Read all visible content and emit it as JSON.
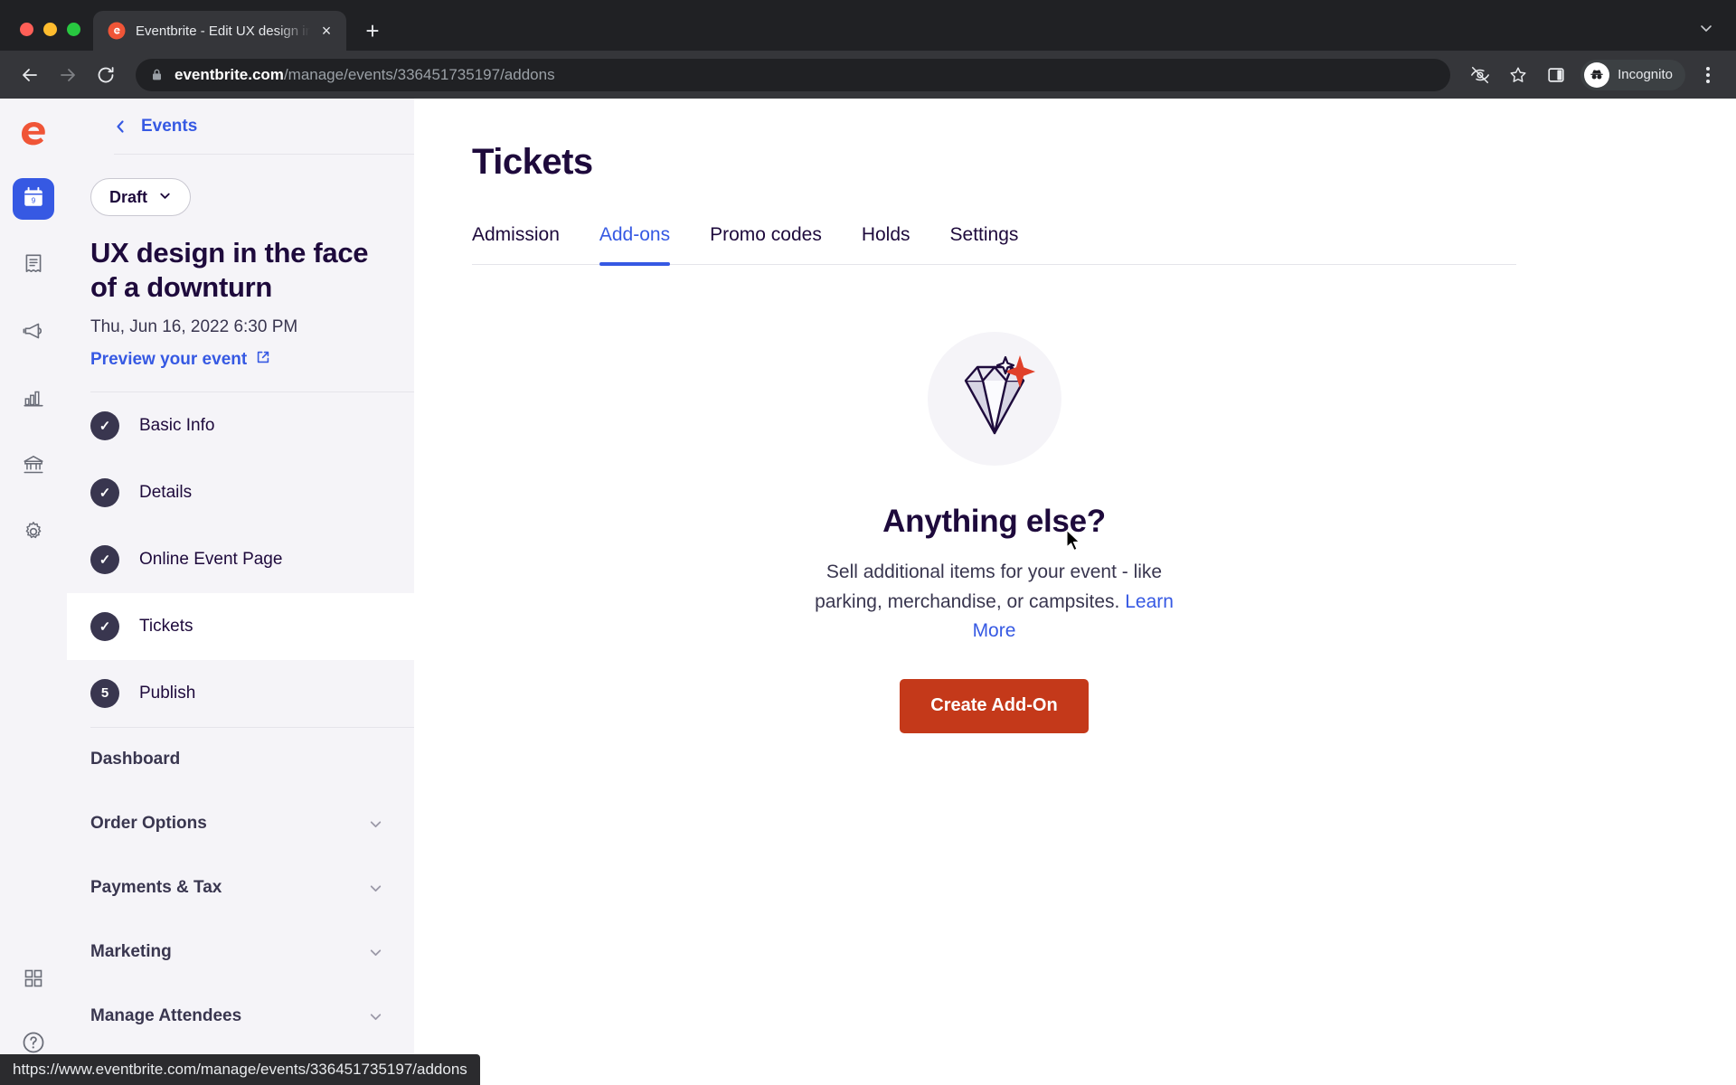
{
  "browser": {
    "tab": {
      "title": "Eventbrite - Edit UX design in t",
      "favicon": "eventbrite-e-icon",
      "close": "×"
    },
    "new_tab_label": "+",
    "expand_label": "⌄",
    "omnibox": {
      "domain": "eventbrite.com",
      "path": "/manage/events/336451735197/addons"
    },
    "profile": {
      "label": "Incognito"
    },
    "status_url": "https://www.eventbrite.com/manage/events/336451735197/addons"
  },
  "rail": {
    "logo": "eventbrite-logo-icon",
    "items": [
      {
        "name": "calendar-icon",
        "active": true
      },
      {
        "name": "orders-receipt-icon",
        "active": false
      },
      {
        "name": "megaphone-icon",
        "active": false
      },
      {
        "name": "bar-chart-icon",
        "active": false
      },
      {
        "name": "bank-icon",
        "active": false
      },
      {
        "name": "gear-icon",
        "active": false
      }
    ],
    "bottom": [
      {
        "name": "apps-grid-icon"
      },
      {
        "name": "help-circle-icon"
      }
    ]
  },
  "sidebar": {
    "back_label": "Events",
    "status_pill": "Draft",
    "event_title": "UX design in the face of a downturn",
    "event_date": "Thu, Jun 16, 2022 6:30 PM",
    "preview_label": "Preview your event",
    "steps": [
      {
        "badge": "✓",
        "label": "Basic Info",
        "active": false
      },
      {
        "badge": "✓",
        "label": "Details",
        "active": false
      },
      {
        "badge": "✓",
        "label": "Online Event Page",
        "active": false
      },
      {
        "badge": "✓",
        "label": "Tickets",
        "active": true
      },
      {
        "badge": "5",
        "label": "Publish",
        "active": false
      }
    ],
    "nav": [
      {
        "label": "Dashboard",
        "chevron": false
      },
      {
        "label": "Order Options",
        "chevron": true
      },
      {
        "label": "Payments & Tax",
        "chevron": true
      },
      {
        "label": "Marketing",
        "chevron": true
      },
      {
        "label": "Manage Attendees",
        "chevron": true
      }
    ]
  },
  "main": {
    "title": "Tickets",
    "tabs": [
      {
        "label": "Admission",
        "selected": false
      },
      {
        "label": "Add-ons",
        "selected": true
      },
      {
        "label": "Promo codes",
        "selected": false
      },
      {
        "label": "Holds",
        "selected": false
      },
      {
        "label": "Settings",
        "selected": false
      }
    ],
    "empty_state": {
      "illustration": "diamond-sparkle-icon",
      "heading": "Anything else?",
      "body": "Sell additional items for your event - like parking, merchandise, or campsites. ",
      "link": "Learn More",
      "cta": "Create Add-On"
    }
  },
  "colors": {
    "accent_blue": "#3659e3",
    "cta_red": "#c4391a",
    "ink": "#1e0a3c",
    "sidebar_bg": "#f5f4f8"
  }
}
